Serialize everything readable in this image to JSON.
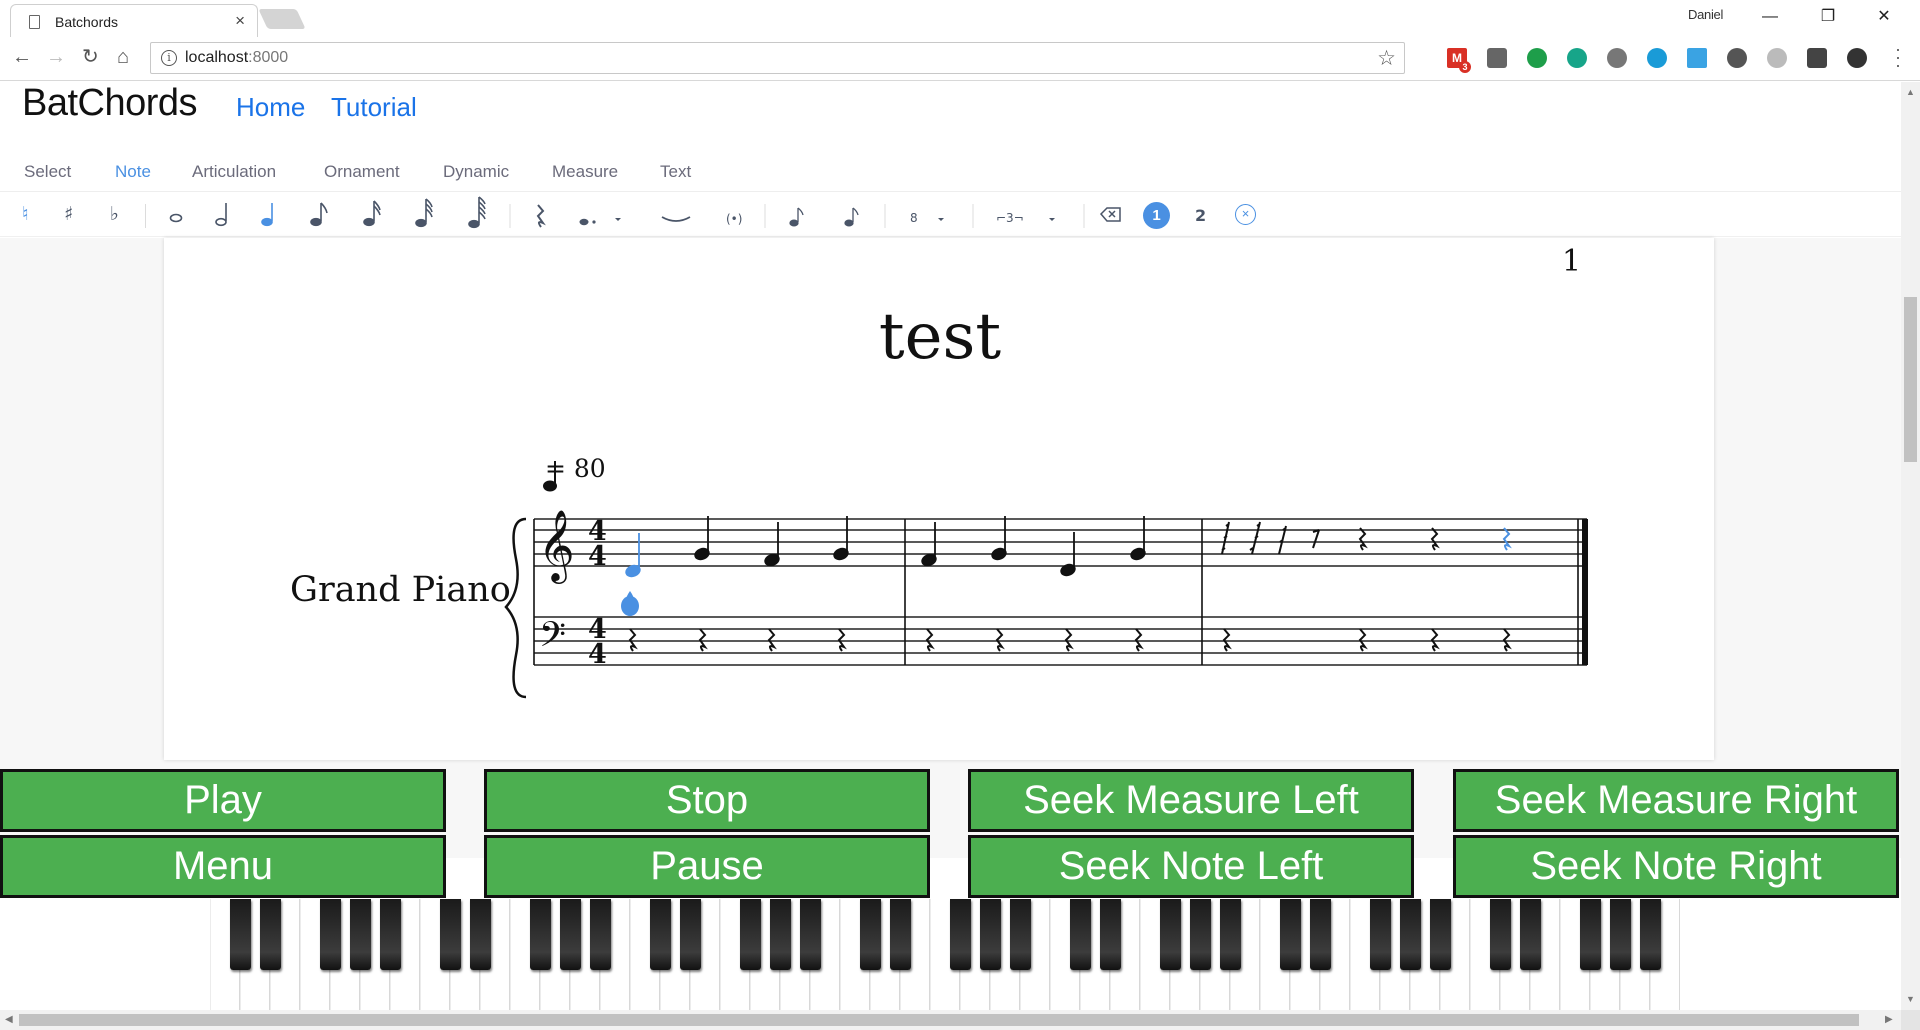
{
  "browser": {
    "tab_title": "Batchords",
    "tab_close": "×",
    "profile_name": "Daniel",
    "url_host": "localhost",
    "url_port": ":8000",
    "extension_badge": "3"
  },
  "app": {
    "brand": "BatChords",
    "nav": [
      "Home",
      "Tutorial"
    ],
    "accent": "#4a90e2",
    "button_color": "#4caf50"
  },
  "modes": [
    "Select",
    "Note",
    "Articulation",
    "Ornament",
    "Dynamic",
    "Measure",
    "Text"
  ],
  "active_mode": "Note",
  "toolbar": {
    "natural": "♮",
    "sharp": "♯",
    "flat": "♭",
    "dot": "•.",
    "octave": "8",
    "tuplet": "⌐3¬",
    "voice_1": "1",
    "voice_2": "2"
  },
  "score": {
    "page_number": "1",
    "title": "test",
    "tempo": "= 80",
    "instrument": "Grand Piano",
    "time_signature": "4/4"
  },
  "controls": {
    "play": "Play",
    "stop": "Stop",
    "seek_measure_left": "Seek Measure Left",
    "seek_measure_right": "Seek Measure Right",
    "menu": "Menu",
    "pause": "Pause",
    "seek_note_left": "Seek Note Left",
    "seek_note_right": "Seek Note Right"
  }
}
